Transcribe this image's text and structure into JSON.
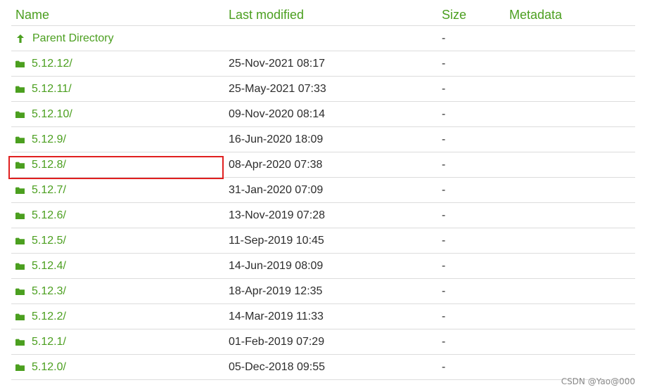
{
  "columns": {
    "name": "Name",
    "last_modified": "Last modified",
    "size": "Size",
    "metadata": "Metadata"
  },
  "parent": {
    "label": "Parent Directory",
    "size": "-",
    "icon": "up-arrow-icon"
  },
  "rows": [
    {
      "name": "5.12.12/",
      "modified": "25-Nov-2021 08:17",
      "size": "-"
    },
    {
      "name": "5.12.11/",
      "modified": "25-May-2021 07:33",
      "size": "-"
    },
    {
      "name": "5.12.10/",
      "modified": "09-Nov-2020 08:14",
      "size": "-"
    },
    {
      "name": "5.12.9/",
      "modified": "16-Jun-2020 18:09",
      "size": "-"
    },
    {
      "name": "5.12.8/",
      "modified": "08-Apr-2020 07:38",
      "size": "-"
    },
    {
      "name": "5.12.7/",
      "modified": "31-Jan-2020 07:09",
      "size": "-"
    },
    {
      "name": "5.12.6/",
      "modified": "13-Nov-2019 07:28",
      "size": "-"
    },
    {
      "name": "5.12.5/",
      "modified": "11-Sep-2019 10:45",
      "size": "-"
    },
    {
      "name": "5.12.4/",
      "modified": "14-Jun-2019 08:09",
      "size": "-"
    },
    {
      "name": "5.12.3/",
      "modified": "18-Apr-2019 12:35",
      "size": "-"
    },
    {
      "name": "5.12.2/",
      "modified": "14-Mar-2019 11:33",
      "size": "-"
    },
    {
      "name": "5.12.1/",
      "modified": "01-Feb-2019 07:29",
      "size": "-"
    },
    {
      "name": "5.12.0/",
      "modified": "05-Dec-2018 09:55",
      "size": "-"
    }
  ],
  "highlighted_row": "5.12.8/",
  "watermark": "CSDN @Yao@000",
  "colors": {
    "accent": "#4b9f1f",
    "text": "#2c2c2c",
    "divider": "#dcdcdc",
    "highlight": "#e02020"
  },
  "row_icon": "folder-icon"
}
